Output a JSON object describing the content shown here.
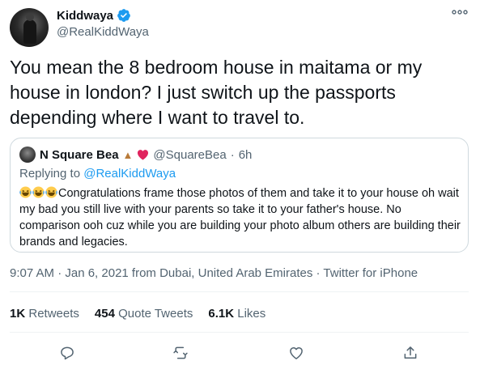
{
  "tweet": {
    "display_name": "Kiddwaya",
    "handle": "@RealKiddWaya",
    "verified": true,
    "text": "You mean the 8 bedroom house in maitama or my house in london? I just switch up the passports depending where I want to travel to.",
    "timestamp": "9:07 AM · Jan 6, 2021 from Dubai, United Arab Emirates · Twitter for iPhone",
    "stats": {
      "retweets_count": "1K",
      "retweets_label": "Retweets",
      "quote_count": "454",
      "quote_label": "Quote Tweets",
      "likes_count": "6.1K",
      "likes_label": "Likes"
    }
  },
  "quote": {
    "display_name": "N Square Bea",
    "name_emojis": [
      "folded-hands-emoji",
      "red-heart-emoji"
    ],
    "handle": "@SquareBea",
    "separator": "·",
    "time": "6h",
    "replying_prefix": "Replying to",
    "replying_handle": "@RealKiddWaya",
    "body_emojis": [
      "laughing-emoji",
      "laughing-emoji",
      "laughing-emoji"
    ],
    "body": "Congratulations frame those photos  of them and take it to your house oh wait my bad you still live with your parents so take it to your father's house. No comparison ooh cuz while you are building your photo album others are building their brands and legacies."
  },
  "actions": [
    "reply-icon",
    "retweet-icon",
    "like-icon",
    "share-icon"
  ],
  "colors": {
    "accent": "#1d9bf0",
    "secondary_text": "#536471",
    "border": "#cfd9de",
    "heart": "#e0245e"
  }
}
